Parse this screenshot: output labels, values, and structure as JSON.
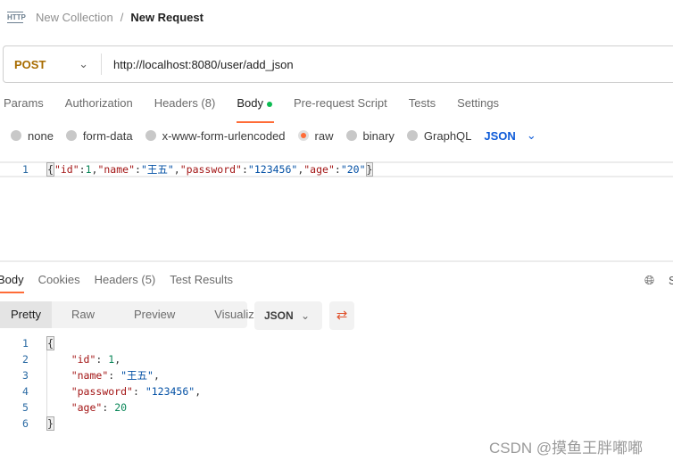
{
  "breadcrumb": {
    "icon": "http-icon",
    "icon_text": "HTTP",
    "collection": "New Collection",
    "separator": "/",
    "request": "New Request"
  },
  "request": {
    "method": "POST",
    "url": "http://localhost:8080/user/add_json"
  },
  "tabs": [
    {
      "label": "Params"
    },
    {
      "label": "Authorization"
    },
    {
      "label": "Headers (8)"
    },
    {
      "label": "Body",
      "active": true
    },
    {
      "label": "Pre-request Script"
    },
    {
      "label": "Tests"
    },
    {
      "label": "Settings"
    }
  ],
  "body_types": [
    {
      "label": "none"
    },
    {
      "label": "form-data"
    },
    {
      "label": "x-www-form-urlencoded"
    },
    {
      "label": "raw",
      "selected": true
    },
    {
      "label": "binary"
    },
    {
      "label": "GraphQL"
    }
  ],
  "body_format": "JSON",
  "request_body": {
    "line": "1",
    "tokens": [
      "{",
      "\"id\"",
      ":",
      "1",
      ",",
      "\"name\"",
      ":",
      "\"王五\"",
      ",",
      "\"password\"",
      ":",
      "\"123456\"",
      ",",
      "\"age\"",
      ":",
      "\"20\"",
      "}"
    ]
  },
  "response_tabs": [
    {
      "label": "Body",
      "active": true
    },
    {
      "label": "Cookies"
    },
    {
      "label": "Headers (5)"
    },
    {
      "label": "Test Results"
    }
  ],
  "view_modes": [
    {
      "label": "Pretty",
      "active": true
    },
    {
      "label": "Raw"
    },
    {
      "label": "Preview"
    },
    {
      "label": "Visualize"
    }
  ],
  "response_format": "JSON",
  "response_lines": [
    {
      "n": "1",
      "k": "",
      "s": "{",
      "t": "p"
    },
    {
      "n": "2",
      "k": "\"id\"",
      "s": "1",
      "t": "n",
      "end": ","
    },
    {
      "n": "3",
      "k": "\"name\"",
      "s": "\"王五\"",
      "t": "s",
      "end": ","
    },
    {
      "n": "4",
      "k": "\"password\"",
      "s": "\"123456\"",
      "t": "s",
      "end": ","
    },
    {
      "n": "5",
      "k": "\"age\"",
      "s": "20",
      "t": "n",
      "end": ""
    },
    {
      "n": "6",
      "k": "",
      "s": "}",
      "t": "p"
    }
  ],
  "right_partial": "S",
  "watermark": "CSDN @摸鱼王胖嘟嘟",
  "colors": {
    "accent": "#ff6c37",
    "method": "#a86c00",
    "link": "#0e5bd8",
    "status_dot": "#0cbb52"
  }
}
